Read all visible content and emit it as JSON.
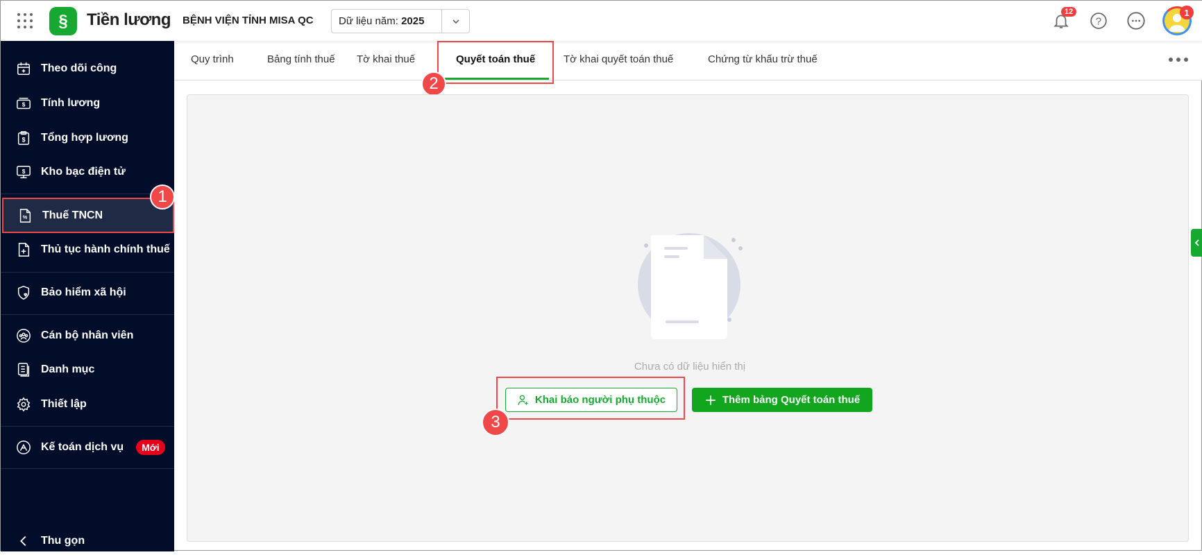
{
  "header": {
    "app_title": "Tiền lương",
    "org_name": "BỆNH VIỆN TỈNH MISA QC",
    "year_label": "Dữ liệu năm:",
    "year_value": "2025",
    "notification_count": "12",
    "avatar_badge": "1",
    "brand_color": "#17a832"
  },
  "sidebar": {
    "items": [
      {
        "label": "Theo dõi công",
        "icon": "calendar-icon"
      },
      {
        "label": "Tính lương",
        "icon": "money-icon"
      },
      {
        "label": "Tổng hợp lương",
        "icon": "clipboard-dollar-icon"
      },
      {
        "label": "Kho bạc điện tử",
        "icon": "monitor-dollar-icon"
      },
      {
        "label": "Thuế TNCN",
        "icon": "tax-file-icon",
        "active": true
      },
      {
        "label": "Thủ tục hành chính thuế",
        "icon": "file-plus-icon"
      },
      {
        "label": "Bảo hiểm xã hội",
        "icon": "shield-heart-icon"
      },
      {
        "label": "Cán bộ nhân viên",
        "icon": "people-icon"
      },
      {
        "label": "Danh mục",
        "icon": "list-icon"
      },
      {
        "label": "Thiết lập",
        "icon": "gear-icon"
      },
      {
        "label": "Kế toán dịch vụ",
        "icon": "accounting-icon",
        "badge": "Mới"
      }
    ],
    "collapse_label": "Thu gọn"
  },
  "tabs": [
    {
      "label": "Quy trình"
    },
    {
      "label": "Bảng tính thuế"
    },
    {
      "label": "Tờ khai thuế"
    },
    {
      "label": "Quyết toán thuế",
      "active": true
    },
    {
      "label": "Tờ khai quyết toán thuế"
    },
    {
      "label": "Chứng từ khấu trừ thuế"
    }
  ],
  "main": {
    "empty_text": "Chưa có dữ liệu hiển thị",
    "declare_dependents_label": "Khai báo người phụ thuộc",
    "add_settlement_label": "Thêm bảng Quyết toán thuế"
  },
  "annotations": {
    "step1": "1",
    "step2": "2",
    "step3": "3"
  }
}
